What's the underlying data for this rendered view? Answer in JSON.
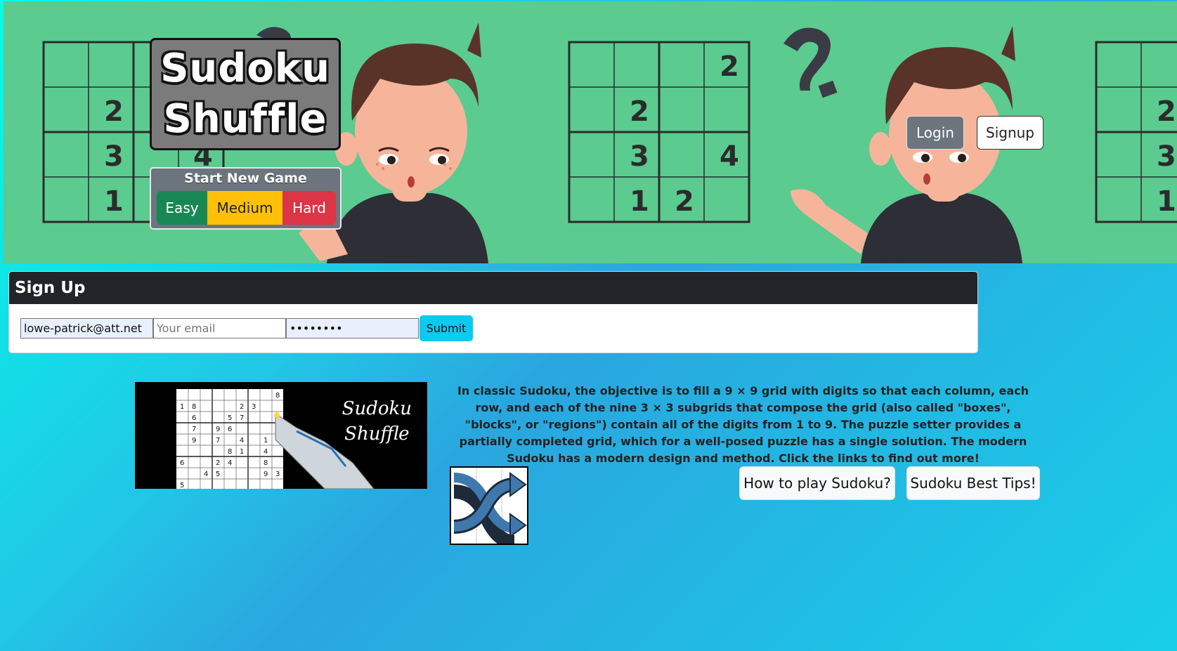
{
  "header": {
    "brand_line1": "Sudoku",
    "brand_line2": "Shuffle",
    "new_game_title": "Start New Game",
    "difficulty": {
      "easy": "Easy",
      "medium": "Medium",
      "hard": "Hard"
    },
    "login_label": "Login",
    "signup_label": "Signup"
  },
  "signup": {
    "title": "Sign Up",
    "username_value": "lowe-patrick@att.net",
    "email_placeholder": "Your email",
    "password_value": "password",
    "submit_label": "Submit"
  },
  "content": {
    "promo_line1": "Sudoku",
    "promo_line2": "Shuffle",
    "description": "In classic Sudoku, the objective is to fill a 9 × 9 grid with digits so that each column, each row, and each of the nine 3 × 3 subgrids that compose the grid (also called \"boxes\", \"blocks\", or \"regions\") contain all of the digits from 1 to 9. The puzzle setter provides a partially completed grid, which for a well-posed puzzle has a single solution. The modern Sudoku has a modern design and method. Click the links to find out more!",
    "how_to_play_label": "How to play Sudoku?",
    "best_tips_label": "Sudoku Best Tips!"
  },
  "colors": {
    "banner_bg": "#5bcb90",
    "easy": "#198754",
    "medium": "#ffc107",
    "hard": "#dc3545",
    "submit": "#0dcaf0",
    "card_header": "#212529"
  },
  "icons": [
    "question-mark-icon",
    "shuffle-icon"
  ]
}
